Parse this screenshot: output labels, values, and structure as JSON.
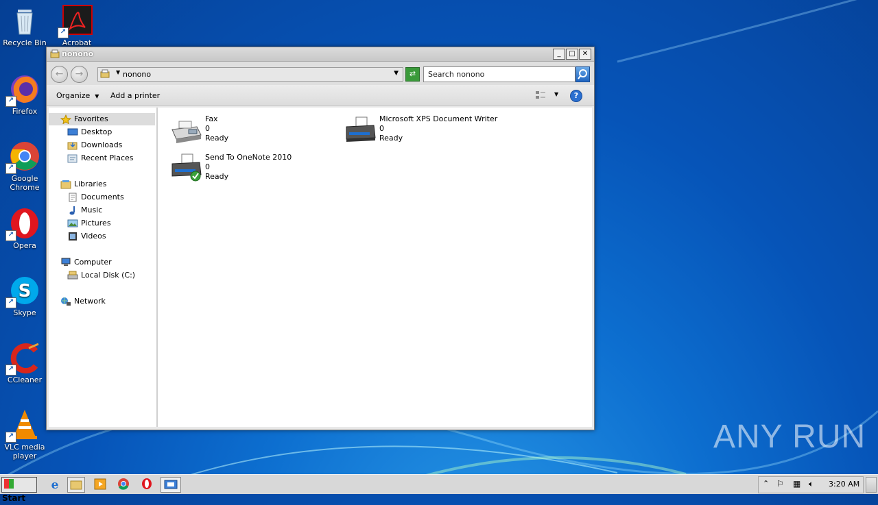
{
  "desktop": {
    "icons": [
      {
        "label": "Recycle Bin"
      },
      {
        "label": "Acrobat"
      },
      {
        "label": "Firefox"
      },
      {
        "label": "Google Chrome"
      },
      {
        "label": "Opera"
      },
      {
        "label": "Skype"
      },
      {
        "label": "CCleaner"
      },
      {
        "label": "VLC media player"
      }
    ],
    "watermark": "ANY RUN"
  },
  "window": {
    "title": "nonono",
    "address": "nonono",
    "search_placeholder": "Search nonono",
    "toolbar": {
      "organize": "Organize",
      "add_printer": "Add a printer"
    },
    "nav": {
      "favorites": "Favorites",
      "desktop": "Desktop",
      "downloads": "Downloads",
      "recent": "Recent Places",
      "libraries": "Libraries",
      "documents": "Documents",
      "music": "Music",
      "pictures": "Pictures",
      "videos": "Videos",
      "computer": "Computer",
      "local_disk": "Local Disk (C:)",
      "network": "Network"
    },
    "printers": [
      {
        "name": "Fax",
        "jobs": "0",
        "status": "Ready"
      },
      {
        "name": "Microsoft XPS Document Writer",
        "jobs": "0",
        "status": "Ready"
      },
      {
        "name": "Send To OneNote 2010",
        "jobs": "0",
        "status": "Ready"
      }
    ]
  },
  "taskbar": {
    "start": "Start",
    "clock": "3:20 AM"
  }
}
